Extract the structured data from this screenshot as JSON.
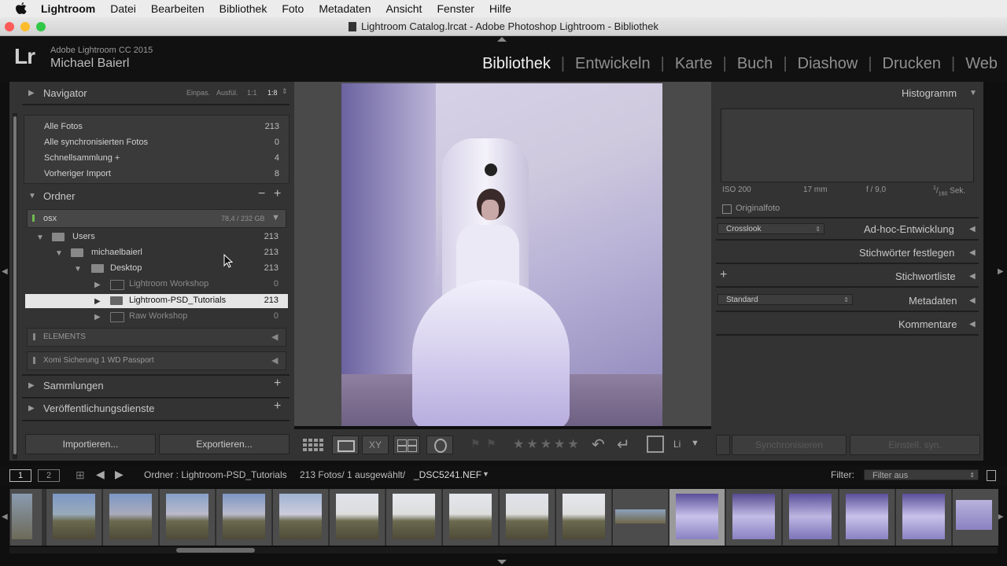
{
  "menubar": {
    "app": "Lightroom",
    "items": [
      "Datei",
      "Bearbeiten",
      "Bibliothek",
      "Foto",
      "Metadaten",
      "Ansicht",
      "Fenster",
      "Hilfe"
    ]
  },
  "window": {
    "title": "Lightroom Catalog.lrcat - Adobe Photoshop Lightroom - Bibliothek"
  },
  "identity": {
    "logo": "Lr",
    "version": "Adobe Lightroom CC 2015",
    "user": "Michael Baierl"
  },
  "modules": [
    "Bibliothek",
    "Entwickeln",
    "Karte",
    "Buch",
    "Diashow",
    "Drucken",
    "Web"
  ],
  "navigator": {
    "title": "Navigator",
    "opts": [
      "Einpas.",
      "Ausfül.",
      "1:1",
      "1:8"
    ]
  },
  "catalog": [
    {
      "label": "Alle Fotos",
      "count": "213"
    },
    {
      "label": "Alle synchronisierten Fotos",
      "count": "0"
    },
    {
      "label": "Schnellsammlung +",
      "count": "4"
    },
    {
      "label": "Vorheriger Import",
      "count": "8"
    }
  ],
  "folders": {
    "title": "Ordner",
    "volume": {
      "name": "osx",
      "size": "78,4 / 232 GB"
    },
    "tree": [
      {
        "label": "Users",
        "count": "213"
      },
      {
        "label": "michaelbaierl",
        "count": "213"
      },
      {
        "label": "Desktop",
        "count": "213"
      },
      {
        "label": "Lightroom Workshop",
        "count": "0"
      },
      {
        "label": "Lightroom-PSD_Tutorials",
        "count": "213"
      },
      {
        "label": "Raw Workshop",
        "count": "0"
      }
    ],
    "volumes2": [
      "ELEMENTS",
      "Xomi Sicherung 1 WD Passport"
    ]
  },
  "left_sections": [
    "Sammlungen",
    "Veröffentlichungsdienste"
  ],
  "left_buttons": {
    "import": "Importieren...",
    "export": "Exportieren..."
  },
  "right": {
    "histogram": "Histogramm",
    "exif": {
      "iso": "ISO 200",
      "focal": "17 mm",
      "aperture": "f / 9,0",
      "shutter_num": "1",
      "shutter_den": "160",
      "shutter_unit": "Sek."
    },
    "original": "Originalfoto",
    "preset": "Crosslook",
    "quick_develop": "Ad-hoc-Entwicklung",
    "keywording": "Stichwörter festlegen",
    "keywordlist": "Stichwortliste",
    "meta_preset": "Standard",
    "metadata": "Metadaten",
    "comments": "Kommentare",
    "sync": "Synchronisieren",
    "sync_settings": "Einstell. syn."
  },
  "toolbar": {
    "sort": "Li"
  },
  "filmbar": {
    "page1": "1",
    "page2": "2",
    "source": "Ordner : Lightroom-PSD_Tutorials",
    "info": "213 Fotos/  1 ausgewählt/",
    "file": "_DSC5241.NEF",
    "filter_label": "Filter:",
    "filter_value": "Filter aus"
  },
  "colors": {
    "accent": "#f2f2f2",
    "panel": "#333333",
    "selected": "#e6e6e6"
  }
}
